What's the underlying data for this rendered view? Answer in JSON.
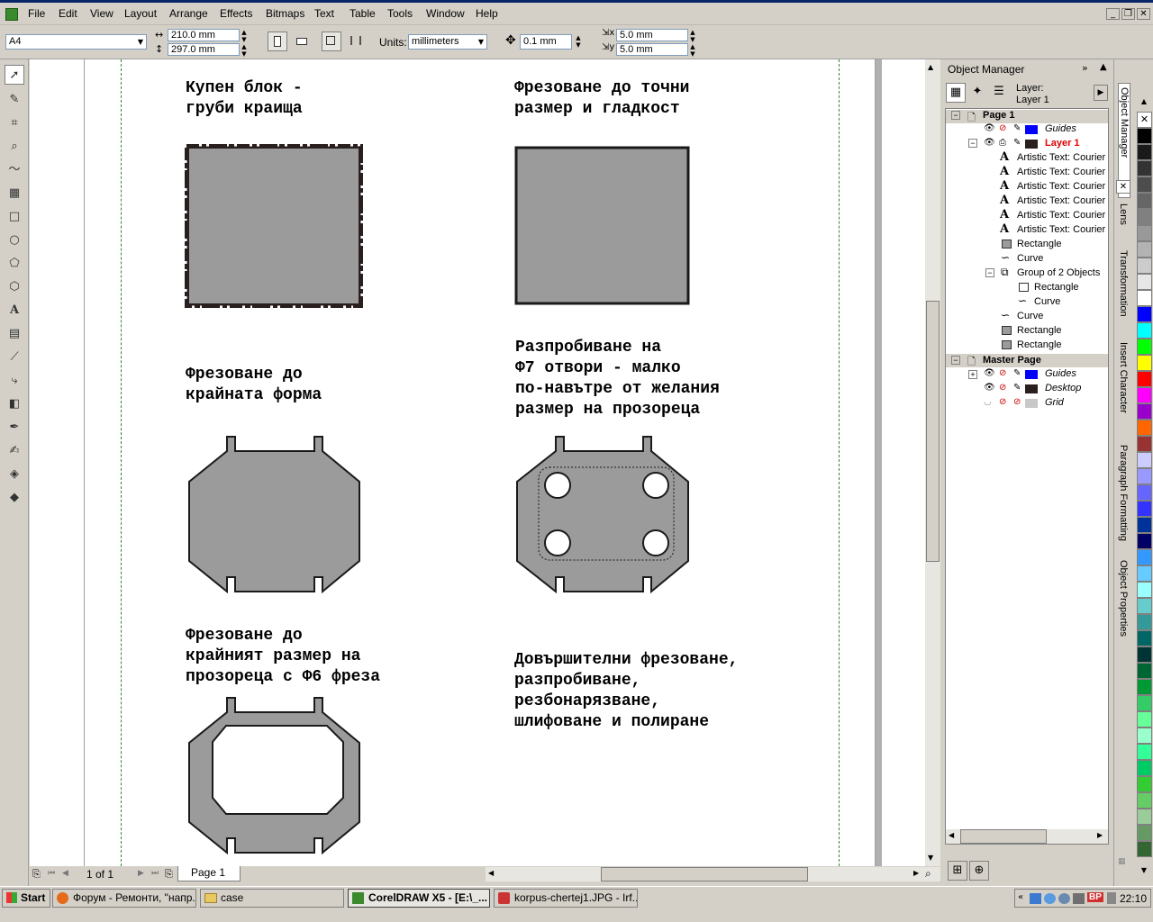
{
  "menubar": {
    "items": [
      "File",
      "Edit",
      "View",
      "Layout",
      "Arrange",
      "Effects",
      "Bitmaps",
      "Text",
      "Table",
      "Tools",
      "Window",
      "Help"
    ]
  },
  "propbar": {
    "page_size": "A4",
    "width": "210.0 mm",
    "height": "297.0 mm",
    "units_label": "Units:",
    "units_value": "millimeters",
    "nudge": "0.1 mm",
    "dup_x": "5.0 mm",
    "dup_y": "5.0 mm"
  },
  "canvas": {
    "texts": {
      "t1": "Купен блок -\nгруби краища",
      "t2": "Фрезоване до точни\nразмер и гладкост",
      "t3": "Фрезоване до\nкрайната форма",
      "t4": "Разпробиване на\nФ7 отвори - малко\nпо-навътре от желания\nразмер на прозореца",
      "t5": "Фрезоване до\nкрайният размер на\nпрозореца с Ф6 фреза",
      "t6": "Довършителни фрезоване,\nразпробиване,\nрезбонарязване,\nшлифоване и полиране"
    }
  },
  "pagebar": {
    "page_count": "1 of 1",
    "page_tab": "Page 1"
  },
  "objmgr": {
    "title": "Object Manager",
    "layer_label": "Layer:",
    "layer_value": "Layer 1",
    "tree": [
      {
        "text": "Page 1",
        "bold": true
      },
      {
        "text": "Guides",
        "italic": true
      },
      {
        "text": "Layer 1",
        "red": true
      },
      {
        "text": "Artistic Text: Courier"
      },
      {
        "text": "Artistic Text: Courier"
      },
      {
        "text": "Artistic Text: Courier"
      },
      {
        "text": "Artistic Text: Courier"
      },
      {
        "text": "Artistic Text: Courier"
      },
      {
        "text": "Artistic Text: Courier"
      },
      {
        "text": "Rectangle"
      },
      {
        "text": "Curve"
      },
      {
        "text": "Group of 2 Objects"
      },
      {
        "text": "Rectangle"
      },
      {
        "text": "Curve"
      },
      {
        "text": "Curve"
      },
      {
        "text": "Rectangle"
      },
      {
        "text": "Rectangle"
      },
      {
        "text": "Master Page",
        "bold": true
      },
      {
        "text": "Guides",
        "italic": true
      },
      {
        "text": "Desktop",
        "italic": true
      },
      {
        "text": "Grid",
        "italic": true
      }
    ]
  },
  "docktabs": [
    "Object Manager",
    "Lens",
    "Transformation",
    "Insert Character",
    "Paragraph Formatting",
    "Object Properties"
  ],
  "palette": [
    "#ffffff",
    "#000000",
    "#1a1a1a",
    "#333333",
    "#4d4d4d",
    "#666666",
    "#808080",
    "#999999",
    "#b3b3b3",
    "#cccccc",
    "#e6e6e6",
    "#ffffff",
    "#0000ff",
    "#00ffff",
    "#00ff00",
    "#ffff00",
    "#ff0000",
    "#ff00ff",
    "#9900cc",
    "#ff6600",
    "#993333",
    "#ccccff",
    "#9999ff",
    "#6666ff",
    "#3333ff",
    "#003399",
    "#000066",
    "#3399ff",
    "#66ccff",
    "#99ffff",
    "#66cccc",
    "#339999",
    "#006666",
    "#003333",
    "#006633",
    "#009933",
    "#33cc66",
    "#66ff99",
    "#99ffcc",
    "#33ff99",
    "#00cc66",
    "#33cc33",
    "#66cc66",
    "#99cc99",
    "#669966",
    "#336633"
  ],
  "taskbar": {
    "start": "Start",
    "tasks": [
      "Форум - Ремонти, \"напр...",
      "case",
      "CorelDRAW X5 - [E:\\_...",
      "korpus-chertej1.JPG - Irf..."
    ],
    "clock": "22:10",
    "lang": "BP"
  }
}
